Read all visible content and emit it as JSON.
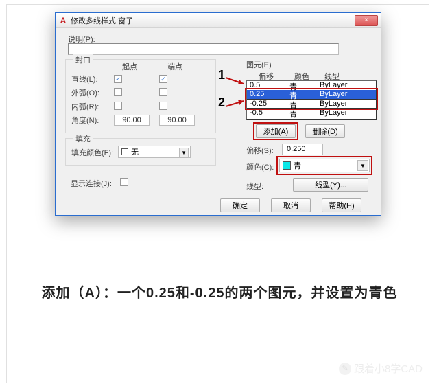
{
  "window": {
    "title": "修改多线样式:窗子",
    "close_glyph": "×",
    "app_glyph": "A"
  },
  "desc": {
    "label": "说明(P):",
    "value": ""
  },
  "cap": {
    "legend": "封口",
    "col_start": "起点",
    "col_end": "端点",
    "rows": {
      "line": {
        "label": "直线(L):",
        "start": true,
        "end": true
      },
      "outer": {
        "label": "外弧(O):",
        "start": false,
        "end": false
      },
      "inner": {
        "label": "内弧(R):",
        "start": false,
        "end": false
      },
      "angle": {
        "label": "角度(N):",
        "start": "90.00",
        "end": "90.00"
      }
    }
  },
  "fill": {
    "legend": "填充",
    "label": "填充颜色(F):",
    "value": "无"
  },
  "chain": {
    "label": "显示连接(J):",
    "checked": false
  },
  "elements": {
    "legend": "图元(E)",
    "headers": {
      "offset": "偏移",
      "color": "颜色",
      "linetype": "线型"
    },
    "rows": [
      {
        "offset": "0.5",
        "color": "青",
        "linetype": "ByLayer",
        "selected": false
      },
      {
        "offset": "0.25",
        "color": "青",
        "linetype": "ByLayer",
        "selected": true
      },
      {
        "offset": "-0.25",
        "color": "青",
        "linetype": "ByLayer",
        "selected": false
      },
      {
        "offset": "-0.5",
        "color": "青",
        "linetype": "ByLayer",
        "selected": false
      }
    ],
    "annot": {
      "n1": "1",
      "n2": "2"
    }
  },
  "buttons": {
    "add": "添加(A)",
    "del": "删除(D)",
    "ok": "确定",
    "cancel": "取消",
    "help": "帮助(H)",
    "linetype": "线型(Y)..."
  },
  "offset": {
    "label": "偏移(S):",
    "value": "0.250"
  },
  "color": {
    "label": "颜色(C):",
    "value": "青"
  },
  "linetype": {
    "label": "线型:"
  },
  "caption": "添加（A）：一个0.25和-0.25的两个图元，并设置为青色",
  "watermark": "跟着小8学CAD"
}
